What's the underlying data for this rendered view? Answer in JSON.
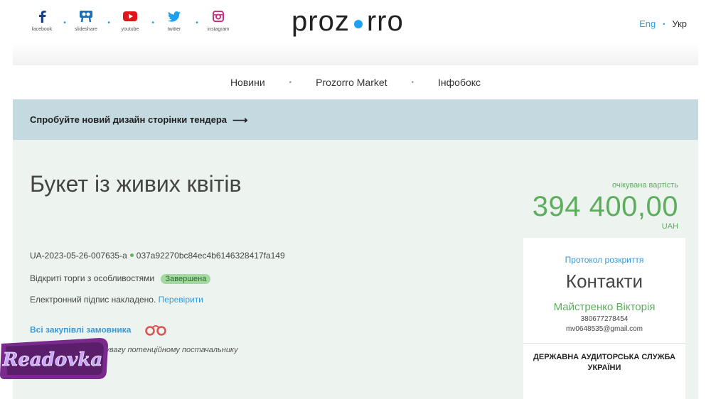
{
  "social": [
    {
      "label": "facebook",
      "icon": "facebook-icon"
    },
    {
      "label": "slideshare",
      "icon": "slideshare-icon"
    },
    {
      "label": "youtube",
      "icon": "youtube-icon"
    },
    {
      "label": "twitter",
      "icon": "twitter-icon"
    },
    {
      "label": "instagram",
      "icon": "instagram-icon"
    }
  ],
  "logo": {
    "left": "proz",
    "right": "rro"
  },
  "lang": {
    "en": "Eng",
    "uk": "Укр"
  },
  "nav": {
    "news": "Новини",
    "market": "Prozorro Market",
    "infobox": "Інфобокс"
  },
  "banner": {
    "text": "Спробуйте новий дизайн сторінки тендера",
    "arrow": "⟶"
  },
  "tender": {
    "title": "Букет із живих квітів",
    "id": "UA-2023-05-26-007635-a",
    "hash": "037a92270bc84ec4b6146328417fa149",
    "procedure": "Відкриті торги з особливостями",
    "status": "Завершена",
    "signature_text": "Електронний підпис накладено.",
    "signature_link": "Перевірити",
    "buyer_purchases": "Всі закупівлі замовника",
    "attention_note": "На що звернути увагу потенційному постачальнику"
  },
  "price": {
    "label": "очікувана вартість",
    "value": "394 400,00",
    "currency": "UAH"
  },
  "contacts": {
    "protocol": "Протокол розкриття",
    "heading": "Контакти",
    "name": "Майстренко Вікторія",
    "phone": "380677278454",
    "email": "mv0648535@gmail.com",
    "org": "ДЕРЖАВНА АУДИТОРСЬКА СЛУЖБА УКРАЇНИ"
  },
  "watermark": {
    "text": "Readovka"
  },
  "colors": {
    "accent_blue": "#1da1f2",
    "green": "#5cae5c",
    "banner": "#c4d9e0",
    "main_bg": "#edf4ef",
    "watermark_purple": "#7a2a8c"
  }
}
